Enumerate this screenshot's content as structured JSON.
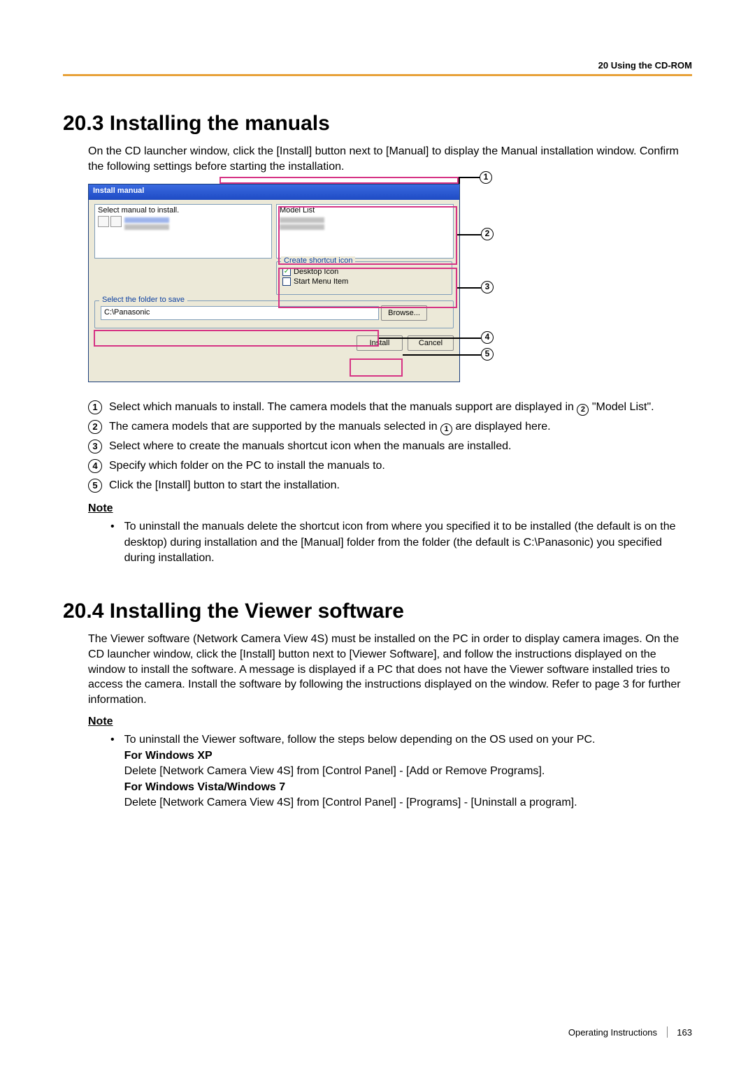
{
  "header": {
    "breadcrumb": "20 Using the CD-ROM"
  },
  "section1": {
    "heading": "20.3  Installing the manuals",
    "intro": "On the CD launcher window, click the [Install] button next to [Manual] to display the Manual installation window. Confirm the following settings before starting the installation."
  },
  "installer": {
    "title": "Install manual",
    "select_label": "Select manual to install.",
    "model_label": "Model List",
    "shortcut_legend": "Create shortcut icon",
    "desktop_icon": "Desktop Icon",
    "start_menu": "Start Menu Item",
    "folder_legend": "Select the folder to save",
    "path": "C:\\Panasonic",
    "browse": "Browse...",
    "install": "Install",
    "cancel": "Cancel"
  },
  "list1": {
    "i1a": "Select which manuals to install. The camera models that the manuals support are displayed in ",
    "i1b": " \"Model List\".",
    "i2a": "The camera models that are supported by the manuals selected in ",
    "i2b": " are displayed here.",
    "i3": "Select where to create the manuals shortcut icon when the manuals are installed.",
    "i4": "Specify which folder on the PC to install the manuals to.",
    "i5": "Click the [Install] button to start the installation."
  },
  "note1": {
    "heading": "Note",
    "text": "To uninstall the manuals delete the shortcut icon from where you specified it to be installed (the default is on the desktop) during installation and the [Manual] folder from the folder (the default is C:\\Panasonic) you specified during installation."
  },
  "section2": {
    "heading": "20.4  Installing the Viewer software",
    "intro": "The Viewer software (Network Camera View 4S) must be installed on the PC in order to display camera images. On the CD launcher window, click the [Install] button next to [Viewer Software], and follow the instructions displayed on the window to install the software. A message is displayed if a PC that does not have the Viewer software installed tries to access the camera. Install the software by following the instructions displayed on the window. Refer to page 3 for further information."
  },
  "note2": {
    "heading": "Note",
    "lead": "To uninstall the Viewer software, follow the steps below depending on the OS used on your PC.",
    "xp_head": "For Windows XP",
    "xp_text": "Delete [Network Camera View 4S] from [Control Panel] - [Add or Remove Programs].",
    "vista_head": "For Windows Vista/Windows 7",
    "vista_text": "Delete [Network Camera View 4S] from [Control Panel] - [Programs] - [Uninstall a program]."
  },
  "footer": {
    "doc": "Operating Instructions",
    "page": "163"
  },
  "nums": {
    "n1": "1",
    "n2": "2",
    "n3": "3",
    "n4": "4",
    "n5": "5"
  }
}
